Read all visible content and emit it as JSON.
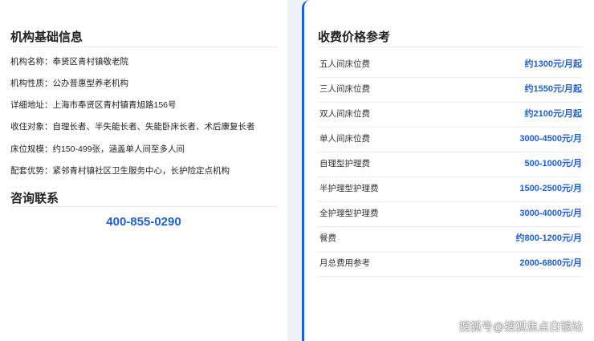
{
  "basic_info": {
    "title": "机构基础信息",
    "rows": [
      "机构名称：奉贤区青村镇敬老院",
      "机构性质：公办普惠型养老机构",
      "详细地址：上海市奉贤区青村镇青旭路156号",
      "收住对象：自理长者、半失能长者、失能卧床长者、术后康复长者",
      "床位规模：约150-499张，涵盖单人间至多人间",
      "配套优势：紧邻青村镇社区卫生服务中心，长护险定点机构"
    ]
  },
  "contact": {
    "title": "咨询联系",
    "phone": "400-855-0290"
  },
  "fees": {
    "title": "收费价格参考",
    "items": [
      {
        "label": "五人间床位费",
        "price": "约1300元/月起"
      },
      {
        "label": "三人间床位费",
        "price": "约1550元/月起"
      },
      {
        "label": "双人间床位费",
        "price": "约2100元/月起"
      },
      {
        "label": "单人间床位费",
        "price": "3000-4500元/月"
      },
      {
        "label": "自理型护理费",
        "price": "500-1000元/月"
      },
      {
        "label": "半护理型护理费",
        "price": "1500-2500元/月"
      },
      {
        "label": "全护理型护理费",
        "price": "3000-4000元/月"
      },
      {
        "label": "餐费",
        "price": "约800-1200元/月"
      },
      {
        "label": "月总费用参考",
        "price": "2000-6800元/月"
      }
    ]
  },
  "watermark": "搜狐号@搜狐焦点白银站",
  "colors": {
    "accent": "#1e5fd9",
    "background": "#eef1f6"
  }
}
